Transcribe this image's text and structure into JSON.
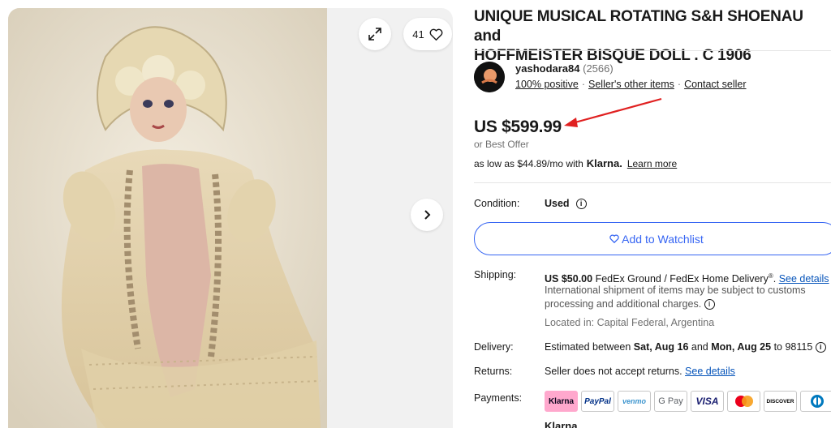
{
  "gallery": {
    "photo_count": "41",
    "photo_alt": "Antique bisque doll in cream lace and pink satin dress"
  },
  "listing": {
    "title_line1": "UNIQUE MUSICAL ROTATING S&H SHOENAU and",
    "title_line2": "HOFFMEISTER BISQUE DOLL . C 1906"
  },
  "seller": {
    "name": "yashodara84",
    "feedback_count": "(2566)",
    "positive": "100% positive",
    "other_items": "Seller's other items",
    "contact": "Contact seller"
  },
  "price": {
    "amount": "US $599.99",
    "best_offer": "or Best Offer",
    "klarna_prefix": "as low as $44.89/mo with",
    "klarna_brand": "Klarna.",
    "learn_more": "Learn more"
  },
  "details": {
    "condition_label": "Condition:",
    "condition_value": "Used",
    "watchlist_label": "Add to Watchlist",
    "shipping_label": "Shipping:",
    "shipping_cost": "US $50.00",
    "shipping_method": "FedEx Ground / FedEx Home Delivery",
    "shipping_reg": "®",
    "see_details": "See details",
    "intl_notice": "International shipment of items may be subject to customs processing and additional charges.",
    "location": "Located in: Capital Federal, Argentina",
    "delivery_label": "Delivery:",
    "delivery_prefix": "Estimated between",
    "delivery_start": "Sat, Aug 16",
    "delivery_and": "and",
    "delivery_end": "Mon, Aug 25",
    "delivery_zip": "to 98115",
    "returns_label": "Returns:",
    "returns_value": "Seller does not accept returns.",
    "returns_link": "See details",
    "payments_label": "Payments:",
    "payment_methods": [
      "Klarna",
      "PayPal",
      "venmo",
      "G Pay",
      "VISA",
      "",
      "DISCOVER",
      ""
    ],
    "klarna_bottom": "Klarna"
  },
  "colors": {
    "accent": "#3665f3",
    "link": "#0654ba",
    "arrow": "#e02020"
  }
}
